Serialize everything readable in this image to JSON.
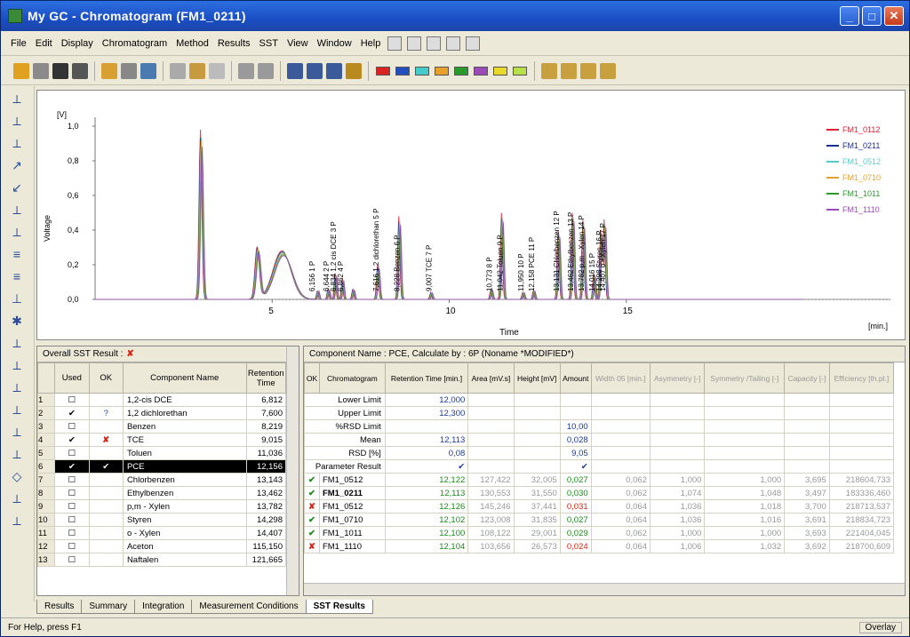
{
  "window": {
    "title": "My GC - Chromatogram (FM1_0211)"
  },
  "menu": [
    "File",
    "Edit",
    "Display",
    "Chromatogram",
    "Method",
    "Results",
    "SST",
    "View",
    "Window",
    "Help"
  ],
  "swatches": [
    "#d22",
    "#224fbf",
    "#4cc",
    "#e9a02a",
    "#2a9a2a",
    "#9a4ab9",
    "#e8d92a",
    "#b9e04a"
  ],
  "chart": {
    "yunit": "[V]",
    "ylabel": "Voltage",
    "xlabel": "Time",
    "xunit": "[min.]",
    "yticks": [
      "1,0",
      "0,8",
      "0,6",
      "0,4",
      "0,2",
      "0,0"
    ],
    "xticks": [
      "5",
      "10",
      "15"
    ]
  },
  "chart_data": {
    "type": "line",
    "xlim": [
      0,
      20
    ],
    "ylim": [
      0,
      1.0
    ],
    "series": [
      {
        "name": "FM1_0112",
        "color": "#d23"
      },
      {
        "name": "FM1_0211",
        "color": "#1a2f8f"
      },
      {
        "name": "FM1_0512",
        "color": "#5cc"
      },
      {
        "name": "FM1_0710",
        "color": "#e9a02a"
      },
      {
        "name": "FM1_1011",
        "color": "#2a9a2a"
      },
      {
        "name": "FM1_1110",
        "color": "#9a4ab9"
      }
    ],
    "peaks": [
      {
        "x": 3.0,
        "y": 0.98,
        "w": 0.08
      },
      {
        "x": 4.6,
        "y": 0.3,
        "w": 0.12
      },
      {
        "x": 5.3,
        "y": 0.28,
        "w": 0.5
      },
      {
        "x": 6.3,
        "y": 0.05,
        "w": 0.05
      },
      {
        "x": 6.6,
        "y": 0.06,
        "w": 0.05
      },
      {
        "x": 6.8,
        "y": 0.15,
        "w": 0.05
      },
      {
        "x": 7.0,
        "y": 0.12,
        "w": 0.05
      },
      {
        "x": 7.3,
        "y": 0.06,
        "w": 0.05
      },
      {
        "x": 8.0,
        "y": 0.2,
        "w": 0.06
      },
      {
        "x": 8.6,
        "y": 0.48,
        "w": 0.06
      },
      {
        "x": 9.5,
        "y": 0.04,
        "w": 0.05
      },
      {
        "x": 11.2,
        "y": 0.06,
        "w": 0.05
      },
      {
        "x": 11.5,
        "y": 0.5,
        "w": 0.06
      },
      {
        "x": 12.1,
        "y": 0.04,
        "w": 0.05
      },
      {
        "x": 12.4,
        "y": 0.05,
        "w": 0.05
      },
      {
        "x": 13.1,
        "y": 0.4,
        "w": 0.06
      },
      {
        "x": 13.5,
        "y": 0.5,
        "w": 0.06
      },
      {
        "x": 13.8,
        "y": 0.46,
        "w": 0.06
      },
      {
        "x": 14.1,
        "y": 0.15,
        "w": 0.05
      },
      {
        "x": 14.3,
        "y": 0.4,
        "w": 0.06
      },
      {
        "x": 14.4,
        "y": 0.46,
        "w": 0.06
      }
    ],
    "peak_labels": [
      {
        "x": 6.2,
        "text": "6,156  1 P"
      },
      {
        "x": 6.6,
        "text": "6,644  2 P"
      },
      {
        "x": 6.8,
        "text": "6,834  1,2 cis DCE  3 P"
      },
      {
        "x": 7.0,
        "text": "6,862  4 P"
      },
      {
        "x": 8.0,
        "text": "7,616  1,2 dichlorethan  5 P"
      },
      {
        "x": 8.6,
        "text": "8,228  Benzen  6 P"
      },
      {
        "x": 9.5,
        "text": "9,007  TCE  7 P"
      },
      {
        "x": 11.2,
        "text": "10,773  8 P"
      },
      {
        "x": 11.5,
        "text": "11,042  Toluen  9 P"
      },
      {
        "x": 12.1,
        "text": "11,950  10 P"
      },
      {
        "x": 12.4,
        "text": "12,158  PCE  11 P"
      },
      {
        "x": 13.1,
        "text": "13,131 Chlorbenzen  12 P"
      },
      {
        "x": 13.5,
        "text": "13,462 Ethylbenzen  13 P"
      },
      {
        "x": 13.8,
        "text": "13,782  p,m - Xylen  14 P"
      },
      {
        "x": 14.1,
        "text": "14,016  15 P"
      },
      {
        "x": 14.3,
        "text": "14,298 Styren  16 P"
      },
      {
        "x": 14.4,
        "text": "14,407  o - Xylen  17 P"
      }
    ]
  },
  "left_panel": {
    "head": "Overall SST Result :",
    "cols": [
      "Used",
      "OK",
      "Component Name",
      "Retention Time"
    ],
    "rows": [
      {
        "n": "1",
        "used": "",
        "ok": "",
        "name": "1,2-cis DCE",
        "rt": "6,812"
      },
      {
        "n": "2",
        "used": "✔",
        "ok": "?",
        "name": "1,2 dichlorethan",
        "rt": "7,600"
      },
      {
        "n": "3",
        "used": "",
        "ok": "",
        "name": "Benzen",
        "rt": "8,219"
      },
      {
        "n": "4",
        "used": "✔",
        "ok": "✘",
        "name": "TCE",
        "rt": "9,015"
      },
      {
        "n": "5",
        "used": "",
        "ok": "",
        "name": "Toluen",
        "rt": "11,036"
      },
      {
        "n": "6",
        "used": "✔",
        "ok": "✔",
        "name": "PCE",
        "rt": "12,156"
      },
      {
        "n": "7",
        "used": "",
        "ok": "",
        "name": "Chlorbenzen",
        "rt": "13,143"
      },
      {
        "n": "8",
        "used": "",
        "ok": "",
        "name": "Ethylbenzen",
        "rt": "13,462"
      },
      {
        "n": "9",
        "used": "",
        "ok": "",
        "name": "p,m - Xylen",
        "rt": "13,782"
      },
      {
        "n": "10",
        "used": "",
        "ok": "",
        "name": "Styren",
        "rt": "14,298"
      },
      {
        "n": "11",
        "used": "",
        "ok": "",
        "name": "o - Xylen",
        "rt": "14,407"
      },
      {
        "n": "12",
        "used": "",
        "ok": "",
        "name": "Aceton",
        "rt": "115,150"
      },
      {
        "n": "13",
        "used": "",
        "ok": "",
        "name": "Naftalen",
        "rt": "121,665"
      }
    ]
  },
  "right_panel": {
    "head": "Component Name : PCE, Calculate by : 6P      (Noname *MODIFIED*)",
    "cols": [
      "OK",
      "Chromatogram",
      "Retention Time [min.]",
      "Area [mV.s]",
      "Height [mV]",
      "Amount",
      "Width 05 [min.]",
      "Asymmetry [-]",
      "Symmetry /Tailing [-]",
      "Capacity [-]",
      "Efficiency [th.pl.]"
    ],
    "stat_rows": [
      {
        "label": "Lower Limit",
        "rt": "12,000",
        "amount": ""
      },
      {
        "label": "Upper Limit",
        "rt": "12,300",
        "amount": ""
      },
      {
        "label": "%RSD Limit",
        "rt": "",
        "amount": "10,00"
      },
      {
        "label": "Mean",
        "rt": "12,113",
        "amount": "0,028"
      },
      {
        "label": "RSD [%]",
        "rt": "0,08",
        "amount": "9,05"
      },
      {
        "label": "Parameter Result",
        "rt": "✔",
        "amount": "✔"
      }
    ],
    "data_rows": [
      {
        "ok": "✔",
        "chrom": "FM1_0512",
        "rt": "12,122",
        "area": "127,422",
        "height": "32,005",
        "amount": "0,027",
        "w05": "0,062",
        "asym": "1,000",
        "sym": "1,000",
        "cap": "3,695",
        "eff": "218604,733"
      },
      {
        "ok": "✔",
        "chrom": "FM1_0211",
        "rt": "12,113",
        "area": "130,553",
        "height": "31,550",
        "amount": "0,030",
        "w05": "0,062",
        "asym": "1,074",
        "sym": "1,048",
        "cap": "3,497",
        "eff": "183336,460"
      },
      {
        "ok": "✘",
        "chrom": "FM1_0512",
        "rt": "12,126",
        "area": "145,246",
        "height": "37,441",
        "amount": "0,031",
        "w05": "0,064",
        "asym": "1,036",
        "sym": "1,018",
        "cap": "3,700",
        "eff": "218713,537"
      },
      {
        "ok": "✔",
        "chrom": "FM1_0710",
        "rt": "12,102",
        "area": "123,008",
        "height": "31,835",
        "amount": "0,027",
        "w05": "0,064",
        "asym": "1,036",
        "sym": "1,016",
        "cap": "3,691",
        "eff": "218834,723"
      },
      {
        "ok": "✔",
        "chrom": "FM1_1011",
        "rt": "12,100",
        "area": "108,122",
        "height": "29,001",
        "amount": "0,029",
        "w05": "0,062",
        "asym": "1,000",
        "sym": "1,000",
        "cap": "3,693",
        "eff": "221404,045"
      },
      {
        "ok": "✘",
        "chrom": "FM1_1110",
        "rt": "12,104",
        "area": "103,656",
        "height": "26,573",
        "amount": "0,024",
        "w05": "0,064",
        "asym": "1,006",
        "sym": "1,032",
        "cap": "3,692",
        "eff": "218700,609"
      }
    ]
  },
  "tabs": [
    "Results",
    "Summary",
    "Integration",
    "Measurement Conditions",
    "SST Results"
  ],
  "status": {
    "left": "For Help, press F1",
    "right": "Overlay"
  }
}
